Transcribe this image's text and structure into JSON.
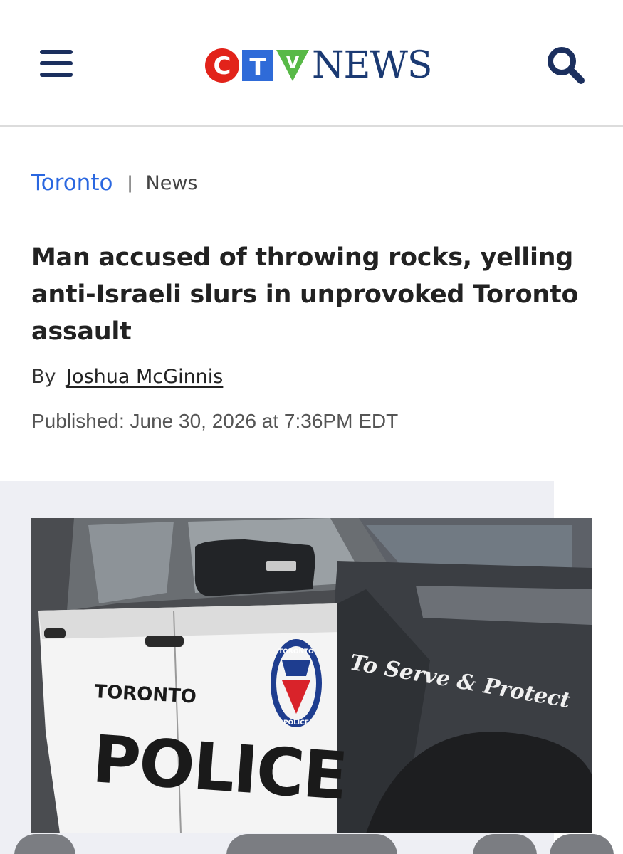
{
  "header": {
    "logo_letters": [
      "C",
      "T",
      "V"
    ],
    "logo_word": "NEWS",
    "brand_colors": {
      "c": "#e2231a",
      "t": "#2f6bd8",
      "v": "#58b947",
      "word": "#1b3a73"
    }
  },
  "breadcrumb": {
    "city": "Toronto",
    "separator": "|",
    "section": "News"
  },
  "article": {
    "headline": "Man accused of throwing rocks, yelling anti-Israeli slurs in unprovoked Toronto assault",
    "by_prefix": "By",
    "author": "Joshua McGinnis",
    "published": "Published: June 30, 2026 at 7:36PM EDT"
  },
  "photo": {
    "door_text_small": "TORONTO",
    "door_text_large": "POLICE",
    "slogan": "To Serve & Protect",
    "badge_top": "TORONTO",
    "badge_bottom": "POLICE"
  },
  "icons": {
    "menu": "hamburger-icon",
    "search": "search-icon"
  }
}
